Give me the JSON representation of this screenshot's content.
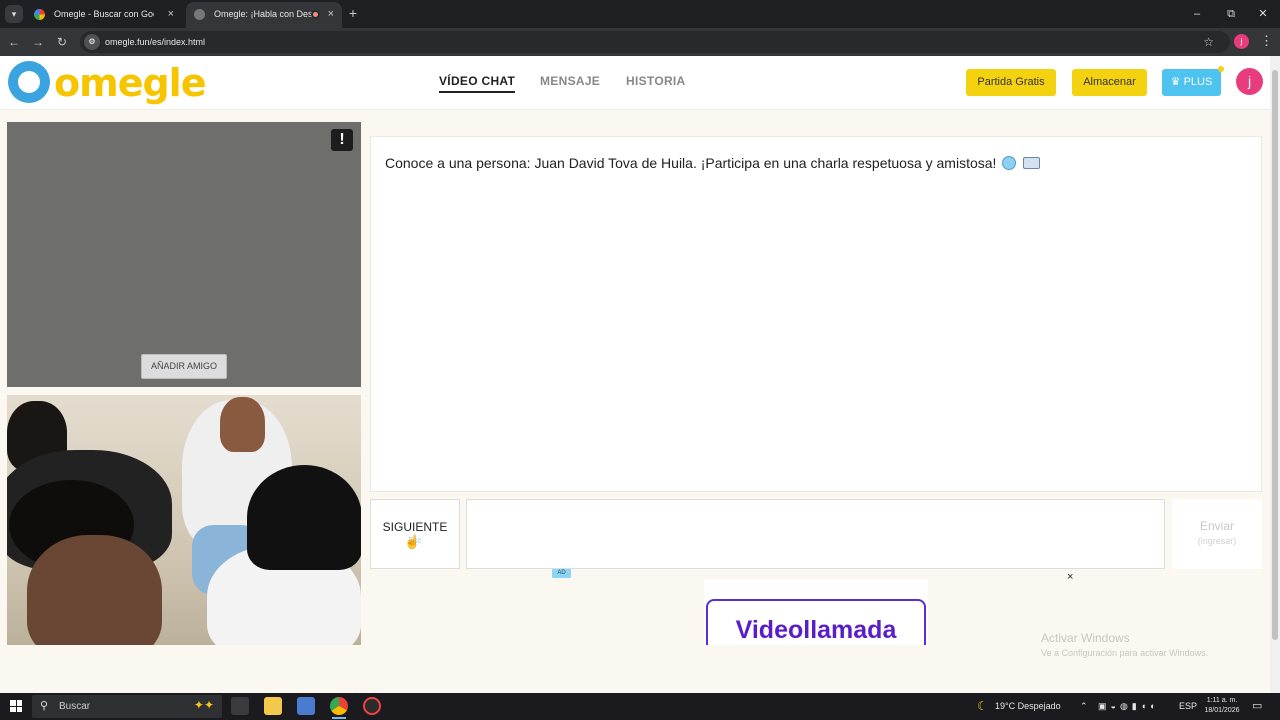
{
  "browser": {
    "tabs": [
      {
        "title": "Omegle - Buscar con Google",
        "close": "×"
      },
      {
        "title": "Omegle: ¡Habla con Descon",
        "close": "×"
      }
    ],
    "new_tab": "+",
    "url": "omegle.fun/es/index.html",
    "profile_initial": "j",
    "window_controls": [
      "–",
      "⧉",
      "✕"
    ]
  },
  "site": {
    "logo_text": "omegle",
    "nav": [
      {
        "label": "VÍDEO CHAT",
        "active": true
      },
      {
        "label": "MENSAJE",
        "active": false
      },
      {
        "label": "HISTORIA",
        "active": false
      }
    ],
    "buttons": {
      "partida_gratis": "Partida Gratis",
      "almacenar": "Almacenar",
      "plus": "♛ PLUS"
    },
    "avatar_initial": "j"
  },
  "video": {
    "report_label": "!",
    "add_friend_label": "AÑADIR AMIGO"
  },
  "chat": {
    "message": "Conoce a una persona: Juan David Tova de Huila. ¡Participa en una charla respetuosa y amistosa!",
    "next_label": "SIGUIENTE",
    "next_sub": "Esc",
    "send_label": "Enviar",
    "send_sub": "(ingresar)"
  },
  "ad": {
    "badge": "AD",
    "close": "×",
    "headline": "Videollamada"
  },
  "watermark": {
    "line1": "Activar Windows",
    "line2": "Ve a Configuración para activar Windows."
  },
  "taskbar": {
    "search_placeholder": "Buscar",
    "weather": "19°C Despejado",
    "language": "ESP",
    "time": "1:11 a. m.",
    "date": "18/01/2026"
  },
  "colors": {
    "accent_yellow": "#f5d210",
    "accent_blue": "#4ec3f0",
    "avatar_pink": "#e73c7e",
    "ad_purple": "#5a1ec8"
  }
}
